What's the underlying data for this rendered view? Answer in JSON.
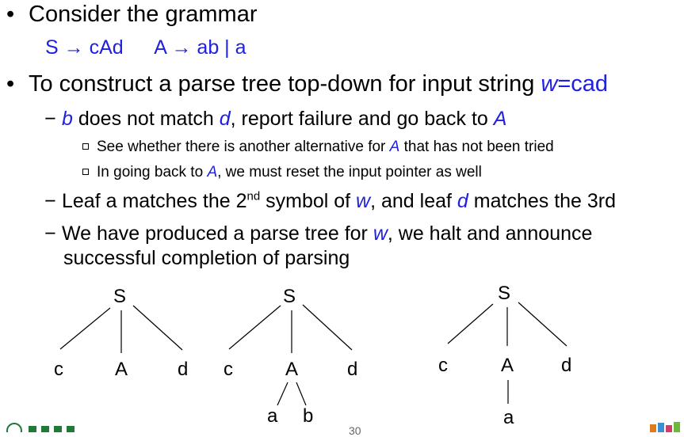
{
  "bullets": {
    "b1": {
      "symbol": "•",
      "text": "Consider the grammar"
    },
    "grammar": {
      "rule1": "S",
      "arrow1": "→",
      "rule1_rhs": "cAd",
      "rule2": "A",
      "arrow2": "→",
      "rule2_rhs": "ab | a"
    },
    "b2": {
      "symbol": "•",
      "text": "To construct a parse tree top-down for input string ",
      "var": "w=cad"
    },
    "d1": {
      "symbol": "−",
      "v1": "b",
      "t1": " does not match ",
      "v2": "d",
      "t2": ", report failure and go back to ",
      "v3": "A"
    },
    "s1": {
      "t1": "See whether there is another alternative for ",
      "v1": "A",
      "t2": " that has not been tried"
    },
    "s2": {
      "t1": "In going back to ",
      "v1": "A",
      "t2": ", we must reset the input pointer as well"
    },
    "d2": {
      "symbol": "−",
      "t1": "Leaf a matches the 2",
      "sup": "nd",
      "t2": " symbol of ",
      "v1": "w",
      "t3": ", and leaf ",
      "v2": "d",
      "t4": " matches the 3rd"
    },
    "d3": {
      "symbol": "−",
      "t1": "We have produced a parse tree for ",
      "v1": "w",
      "t2": ", we halt and announce",
      "t3": "successful completion of parsing"
    }
  },
  "trees": {
    "tree1": {
      "root": "S",
      "c": "c",
      "A": "A",
      "d": "d"
    },
    "tree2": {
      "root": "S",
      "c": "c",
      "A": "A",
      "d": "d",
      "a": "a",
      "b": "b"
    },
    "tree3": {
      "root": "S",
      "c": "c",
      "A": "A",
      "d": "d",
      "a": "a"
    }
  },
  "footer": {
    "page_number": "30"
  }
}
